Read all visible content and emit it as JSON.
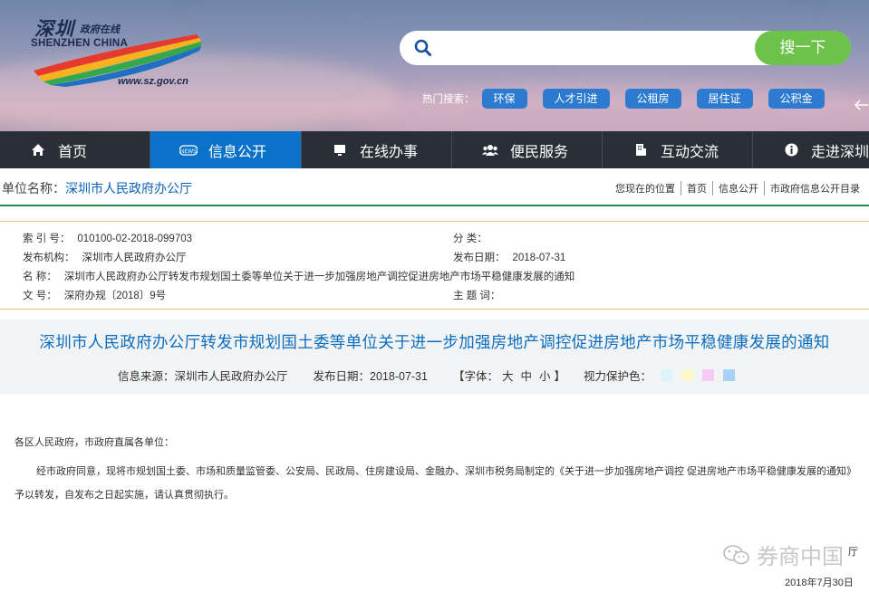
{
  "header": {
    "logo": {
      "cn_big": "深圳",
      "cn_small": "政府在线",
      "en": "SHENZHEN CHINA",
      "url": "www.sz.gov.cn"
    },
    "search": {
      "placeholder": "",
      "button_label": "搜一下"
    },
    "hot_label": "热门搜索：",
    "hot_tags": [
      "环保",
      "人才引进",
      "公租房",
      "居住证",
      "公积金"
    ]
  },
  "nav": {
    "items": [
      {
        "label": "首页",
        "icon": "home-icon"
      },
      {
        "label": "信息公开",
        "icon": "news-icon"
      },
      {
        "label": "在线办事",
        "icon": "monitor-icon"
      },
      {
        "label": "便民服务",
        "icon": "people-icon"
      },
      {
        "label": "互动交流",
        "icon": "building-icon"
      },
      {
        "label": "走进深圳",
        "icon": "info-icon"
      }
    ],
    "active": "信息公开"
  },
  "crumb": {
    "unit_label": "单位名称：",
    "unit_value": "深圳市人民政府办公厅",
    "items": [
      "您现在的位置",
      "首页",
      "信息公开",
      "市政府信息公开目录"
    ]
  },
  "meta": {
    "index_no_label": "索 引 号：",
    "index_no": "010100-02-2018-099703",
    "category_label": "分 类：",
    "category": "",
    "issuer_label": "发布机构：",
    "issuer": "深圳市人民政府办公厅",
    "pub_date_label": "发布日期：",
    "pub_date": "2018-07-31",
    "name_label": "名 称：",
    "name": "深圳市人民政府办公厅转发市规划国土委等单位关于进一步加强房地产调控促进房地产市场平稳健康发展的通知",
    "doc_no_label": "文 号：",
    "doc_no": "深府办规〔2018〕9号",
    "topic_label": "主 题 词：",
    "topic": ""
  },
  "article": {
    "title": "深圳市人民政府办公厅转发市规划国土委等单位关于进一步加强房地产调控促进房地产市场平稳健康发展的通知",
    "source": "信息来源：深圳市人民政府办公厅",
    "date": "发布日期：2018-07-31",
    "font_label_open": "【字体：",
    "font_sizes": [
      "大",
      "中",
      "小"
    ],
    "font_label_close": "】",
    "eye_label": "视力保护色：",
    "eye_colors": [
      "#dff3fb",
      "#fbf7c9",
      "#f5c9f3",
      "#a9d0f5"
    ],
    "salutation": "各区人民政府，市政府直属各单位：",
    "paragraph": "经市政府同意，现将市规划国土委、市场和质量监管委、公安局、民政局、住房建设局、金融办、深圳市税务局制定的《关于进一步加强房地产调控 促进房地产市场平稳健康发展的通知》予以转发，自发布之日起实施，请认真贯彻执行。",
    "signature_partial": "厅",
    "signature_date": "2018年7月30日"
  },
  "watermark": {
    "text": "券商中国"
  }
}
